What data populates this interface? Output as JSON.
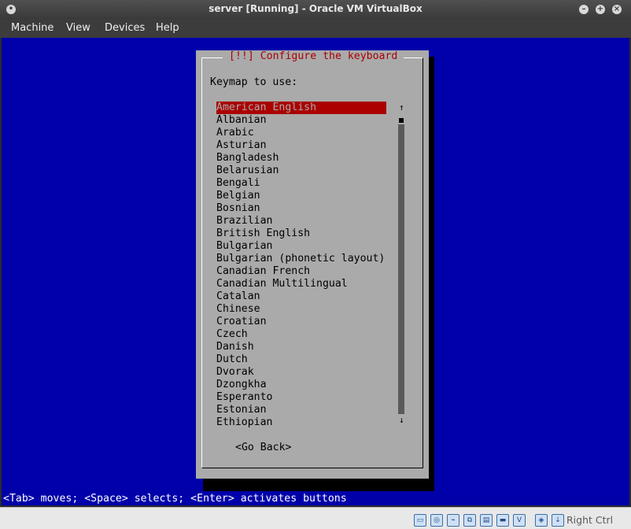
{
  "window": {
    "title": "server [Running] - Oracle VM VirtualBox"
  },
  "menu": [
    "Machine",
    "View",
    "Devices",
    "Help"
  ],
  "installer": {
    "dialog_title": "[!!] Configure the keyboard",
    "prompt": "Keymap to use:",
    "keymaps": [
      "American English",
      "Albanian",
      "Arabic",
      "Asturian",
      "Bangladesh",
      "Belarusian",
      "Bengali",
      "Belgian",
      "Bosnian",
      "Brazilian",
      "British English",
      "Bulgarian",
      "Bulgarian (phonetic layout)",
      "Canadian French",
      "Canadian Multilingual",
      "Catalan",
      "Chinese",
      "Croatian",
      "Czech",
      "Danish",
      "Dutch",
      "Dvorak",
      "Dzongkha",
      "Esperanto",
      "Estonian",
      "Ethiopian"
    ],
    "selected_index": 0,
    "scroll_up_arrow": "↑",
    "scroll_down_arrow": "↓",
    "go_back": "<Go Back>",
    "hint": "<Tab> moves; <Space> selects; <Enter> activates buttons"
  },
  "statusbar": {
    "icons": [
      "hard-disk-icon",
      "optical-drive-icon",
      "usb-icon",
      "network-icon",
      "shared-folders-icon",
      "display-icon",
      "video-capture-icon",
      "mouse-integration-icon",
      "keyboard-capture-icon"
    ],
    "host_key": "Right Ctrl"
  },
  "colors": {
    "screen_bg": "#0000aa",
    "dialog_bg": "#aaaaaa",
    "accent_red": "#aa0000"
  }
}
